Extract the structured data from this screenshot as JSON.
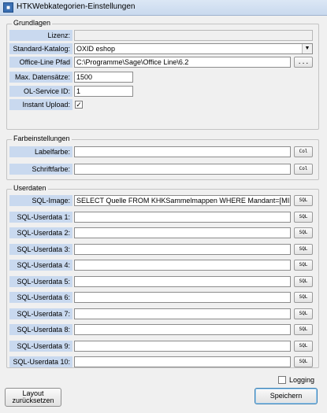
{
  "window": {
    "title": "HTKWebkategorien-Einstellungen"
  },
  "grundlagen": {
    "legend": "Grundlagen",
    "lizenz_label": "Lizenz:",
    "lizenz_value": "",
    "katalog_label": "Standard-Katalog:",
    "katalog_value": "OXID eshop",
    "pfad_label": "Office-Line Pfad",
    "pfad_value": "C:\\Programme\\Sage\\Office Line\\6.2",
    "pfad_button": "...",
    "max_label": "Max. Datensätze:",
    "max_value": "1500",
    "service_label": "OL-Service ID:",
    "service_value": "1",
    "instant_label": "Instant Upload:",
    "instant_checked": "✓"
  },
  "farbe": {
    "legend": "Farbeinstellungen",
    "label_farbe": "Labelfarbe:",
    "label_value": "",
    "schrift_farbe": "Schriftfarbe:",
    "schrift_value": "",
    "button": "Col"
  },
  "userdaten": {
    "legend": "Userdaten",
    "sql_button": "SQL",
    "rows": [
      {
        "label": "SQL-Image:",
        "value": "SELECT Quelle FROM KHKSammelmappen WHERE Mandant=[MID] AND S"
      },
      {
        "label": "SQL-Userdata 1:",
        "value": ""
      },
      {
        "label": "SQL-Userdata 2:",
        "value": ""
      },
      {
        "label": "SQL-Userdata 3:",
        "value": ""
      },
      {
        "label": "SQL-Userdata 4:",
        "value": ""
      },
      {
        "label": "SQL-Userdata 5:",
        "value": ""
      },
      {
        "label": "SQL-Userdata 6:",
        "value": ""
      },
      {
        "label": "SQL-Userdata 7:",
        "value": ""
      },
      {
        "label": "SQL-Userdata 8:",
        "value": ""
      },
      {
        "label": "SQL-Userdata 9:",
        "value": ""
      },
      {
        "label": "SQL-Userdata 10:",
        "value": ""
      }
    ]
  },
  "footer": {
    "logging_label": "Logging",
    "reset_line1": "Layout",
    "reset_line2": "zurücksetzen",
    "save_label": "Speichern"
  }
}
